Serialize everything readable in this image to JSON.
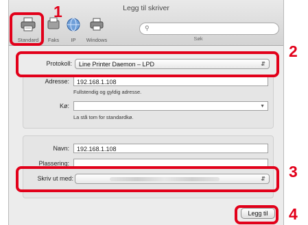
{
  "window": {
    "title": "Legg til skriver"
  },
  "toolbar": {
    "standard": "Standard",
    "faks": "Faks",
    "ip": "IP",
    "windows": "Windows",
    "search_placeholder": "",
    "search_label": "Søk"
  },
  "protocol": {
    "label": "Protokoll:",
    "value": "Line Printer Daemon – LPD"
  },
  "address": {
    "label": "Adresse:",
    "value": "192.168.1.108",
    "hint": "Fullstendig og gyldig adresse."
  },
  "queue": {
    "label": "Kø:",
    "value": "",
    "hint": "La stå tom for standardkø."
  },
  "name": {
    "label": "Navn:",
    "value": "192.168.1.108"
  },
  "location": {
    "label": "Plassering:",
    "value": ""
  },
  "print_with": {
    "label": "Skriv ut med:",
    "value": ""
  },
  "buttons": {
    "add": "Legg til"
  },
  "callouts": {
    "n1": "1",
    "n2": "2",
    "n3": "3",
    "n4": "4"
  },
  "colors": {
    "highlight": "#e2001a"
  }
}
